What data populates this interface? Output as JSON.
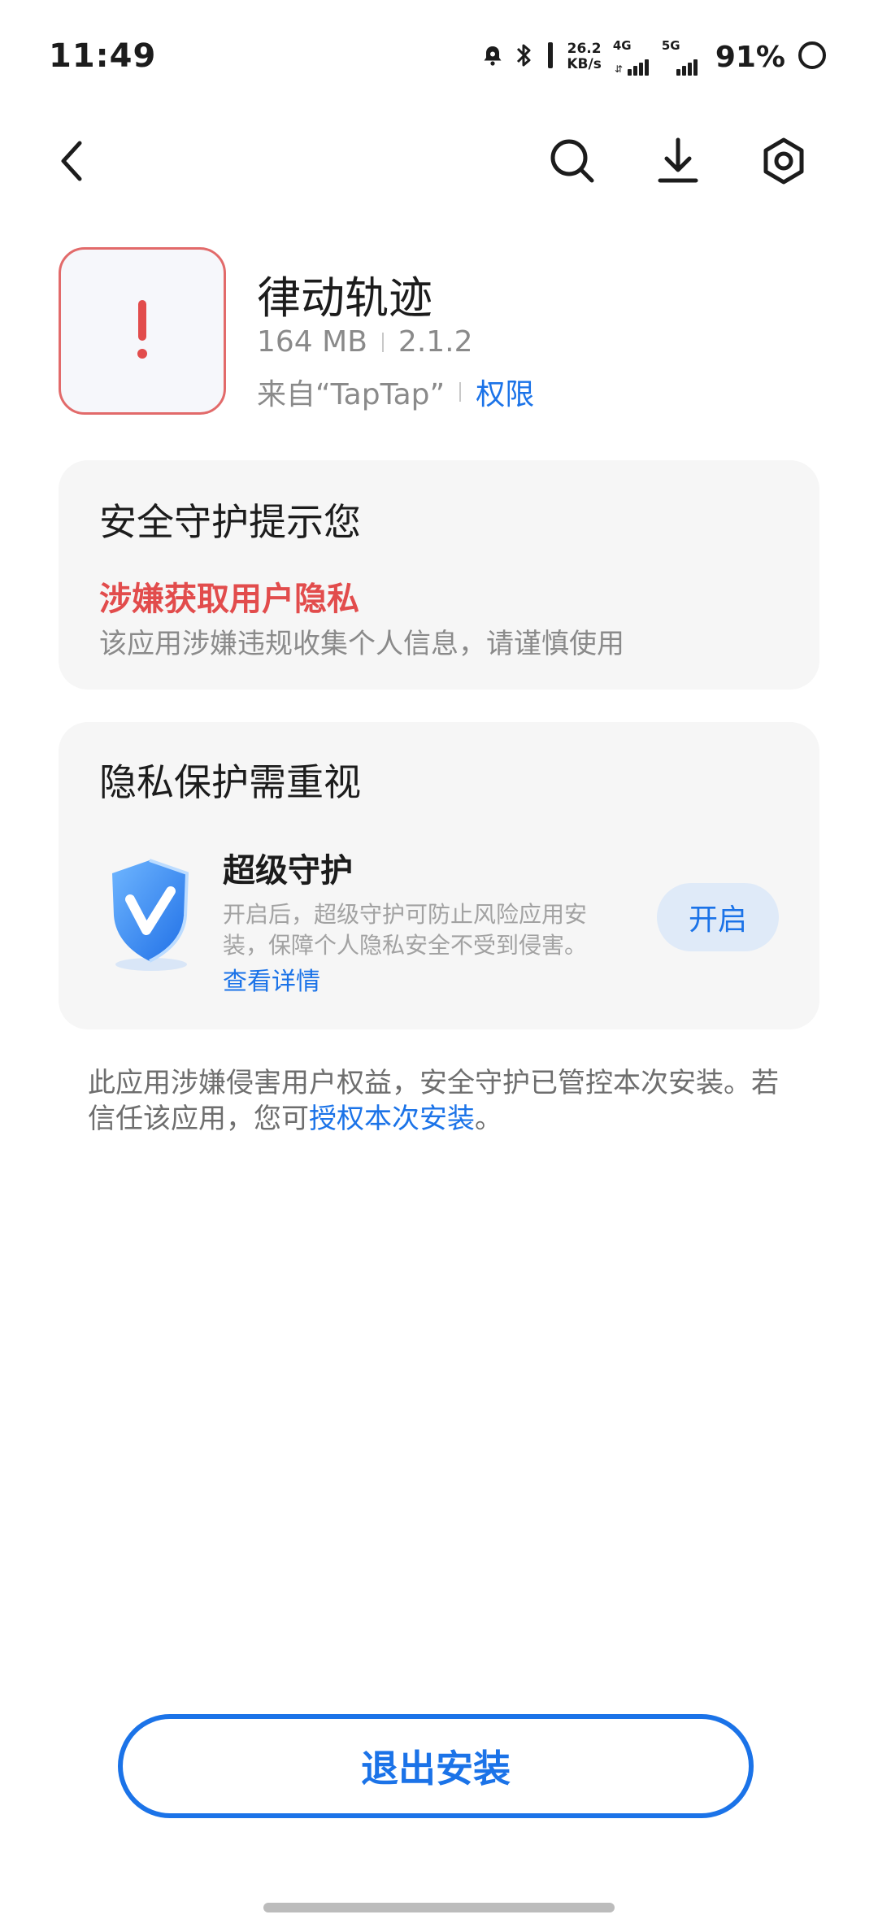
{
  "status_bar": {
    "time": "11:49",
    "net_speed_value": "26.2",
    "net_speed_unit": "KB/s",
    "sim1_type": "4G",
    "sim2_type": "5G",
    "battery_percent": "91%",
    "icons": [
      "alarm-icon",
      "bluetooth-icon",
      "vibrate-icon",
      "signal-icon",
      "battery-ring-icon"
    ]
  },
  "nav": {
    "icons": [
      "back-icon",
      "search-icon",
      "download-icon",
      "settings-icon"
    ]
  },
  "app": {
    "name": "律动轨迹",
    "size": "164 MB",
    "version": "2.1.2",
    "source": "来自“TapTap”",
    "permissions_link": "权限",
    "icon": "warning-exclamation-icon",
    "icon_border_color": "#e26a6a"
  },
  "security_card": {
    "title": "安全守护提示您",
    "risk_title": "涉嫌获取用户隐私",
    "risk_description": "该应用涉嫌违规收集个人信息，请谨慎使用",
    "risk_color": "#e24c4c"
  },
  "privacy_card": {
    "title": "隐私保护需重视",
    "feature_title": "超级守护",
    "feature_description": "开启后，超级守护可防止风险应用安装，保障个人隐私安全不受到侵害。",
    "feature_link": "查看详情",
    "enable_button": "开启",
    "icon": "shield-v-icon"
  },
  "notice": {
    "text_before": "此应用涉嫌侵害用户权益，安全守护已管控本次安装。若信任该应用，您可",
    "link": "授权本次安装",
    "text_after": "。"
  },
  "footer": {
    "exit_button": "退出安装"
  },
  "colors": {
    "accent": "#1b73e8",
    "card_bg": "#f6f6f6",
    "danger": "#e24c4c"
  }
}
